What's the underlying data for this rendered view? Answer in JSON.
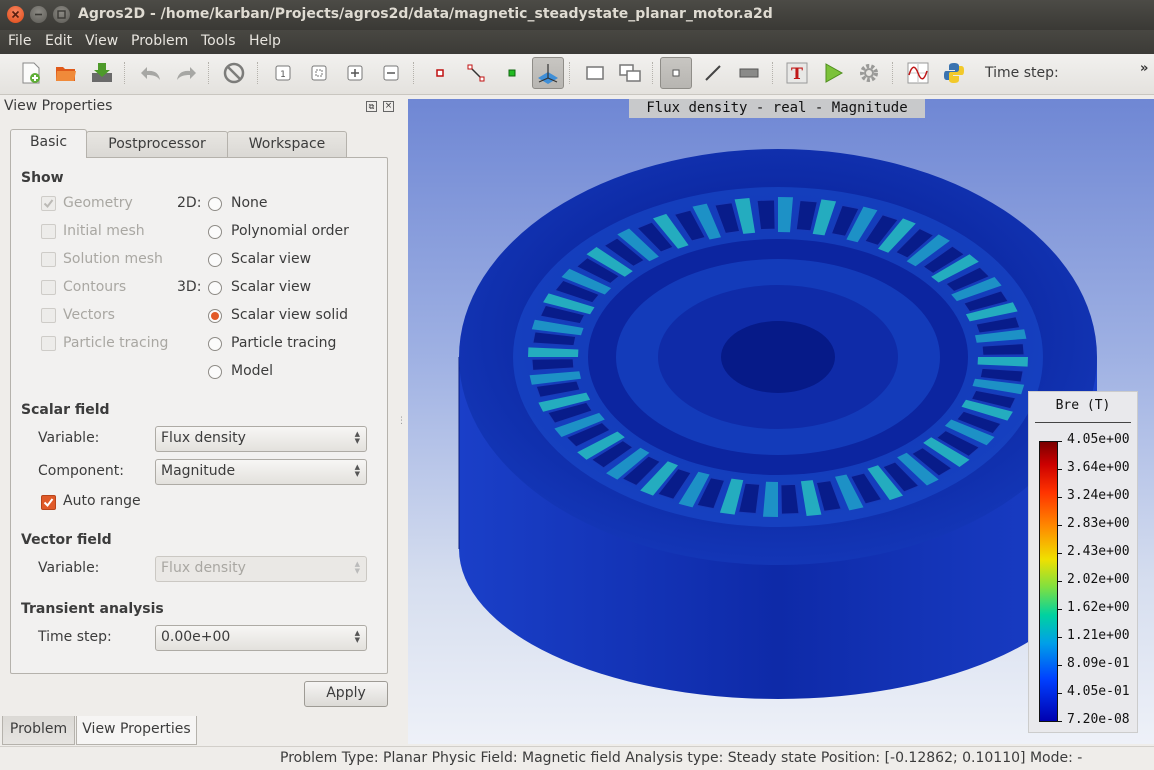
{
  "window": {
    "title": "Agros2D - /home/karban/Projects/agros2d/data/magnetic_steadystate_planar_motor.a2d"
  },
  "menu": [
    {
      "label": "File"
    },
    {
      "label": "Edit"
    },
    {
      "label": "View"
    },
    {
      "label": "Problem"
    },
    {
      "label": "Tools"
    },
    {
      "label": "Help"
    }
  ],
  "toolbar": {
    "time_step_label": "Time step:",
    "extension": "»"
  },
  "dock": {
    "title": "View Properties",
    "float_glyph": "⧉",
    "close_glyph": "×",
    "tabs": [
      "Basic",
      "Postprocessor",
      "Workspace"
    ],
    "bottom_tabs": [
      "Problem",
      "View Properties"
    ]
  },
  "show": {
    "heading": "Show",
    "checkboxes": [
      {
        "label": "Geometry",
        "checked": true
      },
      {
        "label": "Initial mesh",
        "checked": false
      },
      {
        "label": "Solution mesh",
        "checked": false
      },
      {
        "label": "Contours",
        "checked": false
      },
      {
        "label": "Vectors",
        "checked": false
      },
      {
        "label": "Particle tracing",
        "checked": false
      }
    ],
    "dim2_label": "2D:",
    "dim3_label": "3D:",
    "radios": [
      {
        "label": "None",
        "selected": false
      },
      {
        "label": "Polynomial order",
        "selected": false
      },
      {
        "label": "Scalar view",
        "selected": false
      },
      {
        "label": "Scalar view",
        "selected": false
      },
      {
        "label": "Scalar view solid",
        "selected": true
      },
      {
        "label": "Particle tracing",
        "selected": false
      },
      {
        "label": "Model",
        "selected": false
      }
    ]
  },
  "scalar_field": {
    "heading": "Scalar field",
    "variable_label": "Variable:",
    "variable_value": "Flux density",
    "component_label": "Component:",
    "component_value": "Magnitude",
    "auto_range_label": "Auto range",
    "auto_range_checked": true
  },
  "vector_field": {
    "heading": "Vector field",
    "variable_label": "Variable:",
    "variable_value": "Flux density"
  },
  "transient": {
    "heading": "Transient analysis",
    "time_step_label": "Time step:",
    "time_step_value": "0.00e+00"
  },
  "apply_label": "Apply",
  "view": {
    "title": "Flux density - real - Magnitude",
    "legend_title": "Bre (T)",
    "legend_values": [
      "4.05e+00",
      "3.64e+00",
      "3.24e+00",
      "2.83e+00",
      "2.43e+00",
      "2.02e+00",
      "1.62e+00",
      "1.21e+00",
      "8.09e-01",
      "4.05e-01",
      "7.20e-08"
    ],
    "colors": {
      "background_top": "#6f87d4",
      "background_bottom": "#eef1f8",
      "field_low": "#0a1e8c",
      "field_high": "#cc0000"
    }
  },
  "status": {
    "text": "Problem Type: Planar  Physic Field: Magnetic field  Analysis type: Steady state  Position: [-0.12862;  0.10110]  Mode: -"
  }
}
